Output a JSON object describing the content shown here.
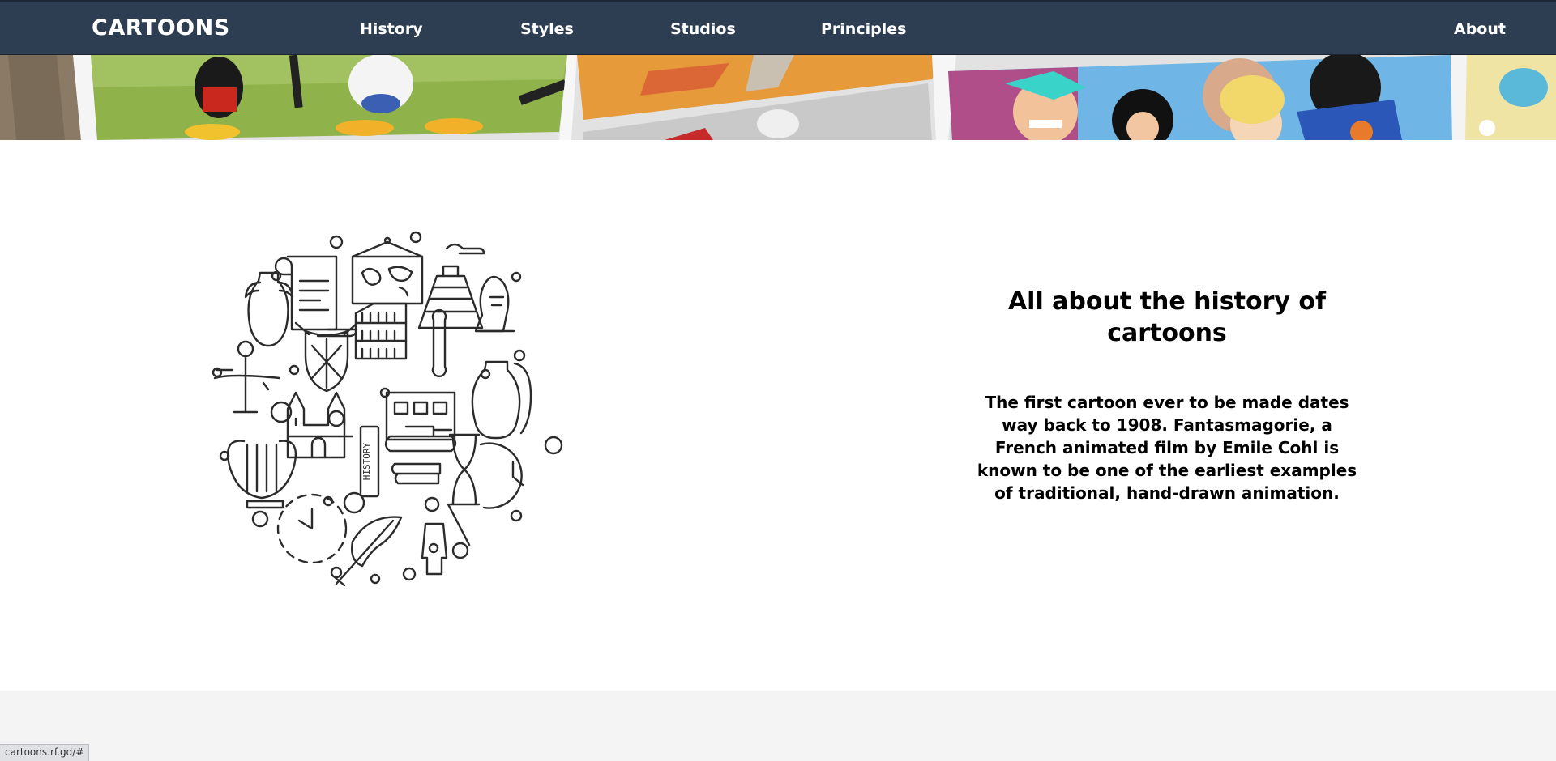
{
  "nav": {
    "brand": "CARTOONS",
    "links": [
      "History",
      "Styles",
      "Studios",
      "Principles",
      "About"
    ]
  },
  "main": {
    "heading": "All about the history of cartoons",
    "body": "The first cartoon ever to be made dates way back to 1908. Fantasmagorie, a French animated film by Emile Cohl is known to be one of the earliest examples of traditional, hand-drawn animation.",
    "illustration_label": "HISTORY"
  },
  "status_bar": {
    "url": "cartoons.rf.gd/#"
  },
  "colors": {
    "navbar": "#2e3e52",
    "nav_text": "#ffffff",
    "footer": "#f4f4f5",
    "heading": "#000000"
  }
}
